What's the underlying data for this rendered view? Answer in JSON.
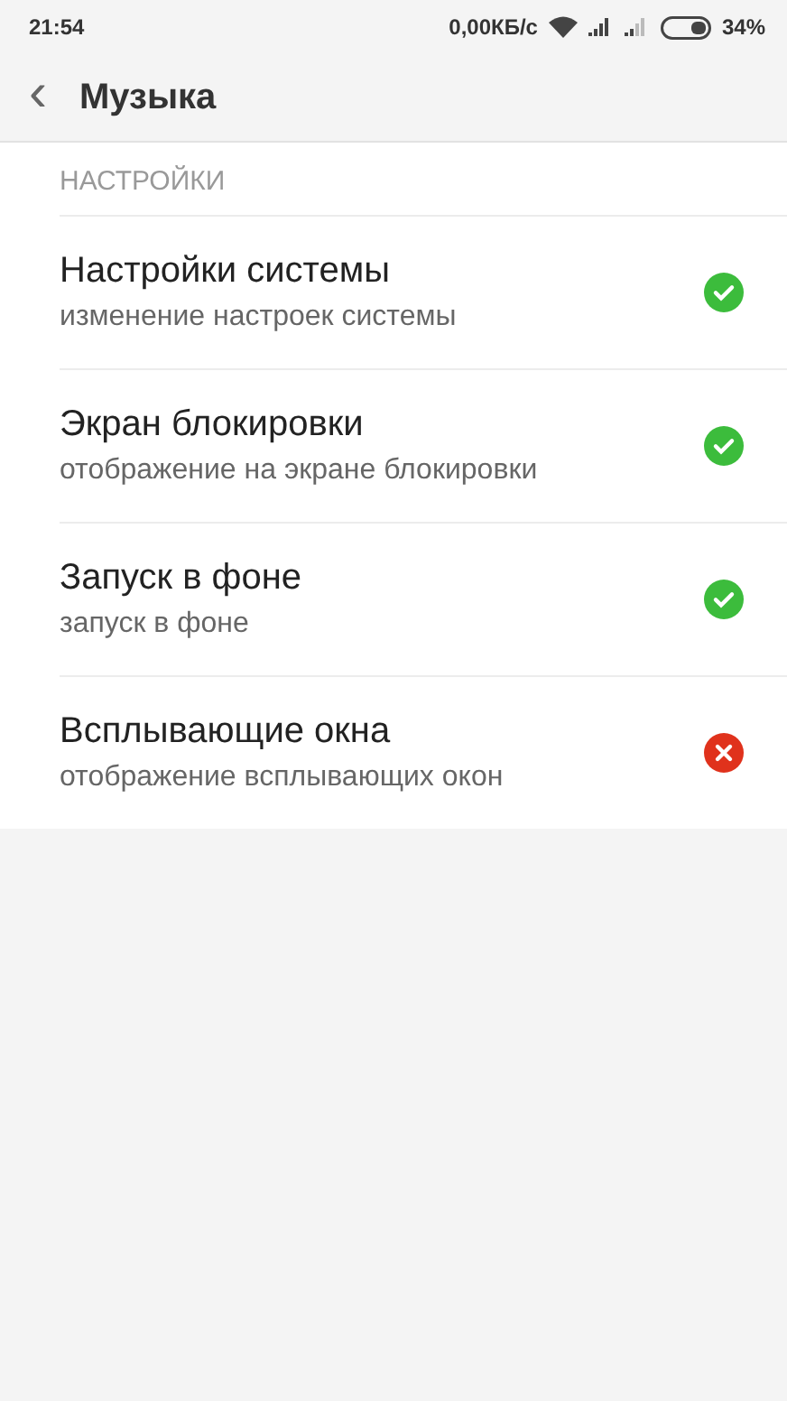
{
  "status_bar": {
    "time": "21:54",
    "speed": "0,00КБ/с",
    "battery": "34%"
  },
  "header": {
    "back": "‹",
    "title": "Музыка"
  },
  "section": {
    "title": "НАСТРОЙКИ",
    "items": [
      {
        "title": "Настройки системы",
        "subtitle": "изменение настроек системы",
        "granted": true
      },
      {
        "title": "Экран блокировки",
        "subtitle": "отображение на экране блокировки",
        "granted": true
      },
      {
        "title": "Запуск в фоне",
        "subtitle": "запуск в фоне",
        "granted": true
      },
      {
        "title": "Всплывающие окна",
        "subtitle": "отображение всплывающих окон",
        "granted": false
      }
    ]
  }
}
